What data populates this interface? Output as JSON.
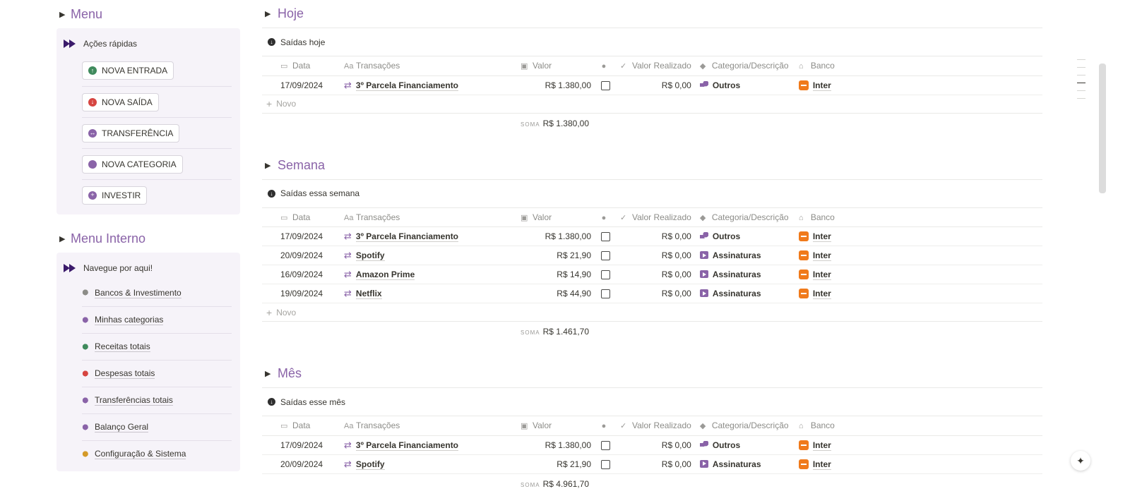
{
  "menu": {
    "title": "Menu",
    "panel_title": "Ações rápidas",
    "buttons": [
      {
        "label": "NOVA ENTRADA",
        "color": "#3f8a5c",
        "glyph": "↑"
      },
      {
        "label": "NOVA SAÍDA",
        "color": "#d64541",
        "glyph": "↓"
      },
      {
        "label": "TRANSFERÊNCIA",
        "color": "#8a63a8",
        "glyph": "↔"
      },
      {
        "label": "NOVA CATEGORIA",
        "color": "#8a63a8",
        "glyph": ""
      },
      {
        "label": "INVESTIR",
        "color": "#8a63a8",
        "glyph": "+"
      }
    ]
  },
  "menu_interno": {
    "title": "Menu Interno",
    "panel_title": "Navegue por aqui!",
    "items": [
      {
        "label": "Bancos & Investimento",
        "icon": "bank-icon"
      },
      {
        "label": "Minhas categorias",
        "icon": "shapes-icon"
      },
      {
        "label": "Receitas totais",
        "icon": "income-icon"
      },
      {
        "label": "Despesas totais",
        "icon": "expense-icon"
      },
      {
        "label": "Transferências totais",
        "icon": "transfer-icon"
      },
      {
        "label": "Balanço Geral",
        "icon": "balance-icon"
      },
      {
        "label": "Configuração & Sistema",
        "icon": "settings-icon"
      }
    ]
  },
  "columns": {
    "date": "Data",
    "transactions": "Transações",
    "value": "Valor",
    "realized": "Valor Realizado",
    "category": "Categoria/Descrição",
    "bank": "Banco"
  },
  "new_label": "Novo",
  "sum_label": "SOMA",
  "sections": [
    {
      "title": "Hoje",
      "view_title": "Saídas hoje",
      "sum": "R$ 1.380,00",
      "rows": [
        {
          "date": "17/09/2024",
          "name": "3º Parcela Financiamento",
          "value": "R$ 1.380,00",
          "realized": "R$ 0,00",
          "category": "Outros",
          "cat_icon": "outros",
          "bank": "Inter"
        }
      ],
      "show_new": true
    },
    {
      "title": "Semana",
      "view_title": "Saídas essa semana",
      "sum": "R$ 1.461,70",
      "rows": [
        {
          "date": "17/09/2024",
          "name": "3º Parcela Financiamento",
          "value": "R$ 1.380,00",
          "realized": "R$ 0,00",
          "category": "Outros",
          "cat_icon": "outros",
          "bank": "Inter"
        },
        {
          "date": "20/09/2024",
          "name": "Spotify",
          "value": "R$ 21,90",
          "realized": "R$ 0,00",
          "category": "Assinaturas",
          "cat_icon": "play",
          "bank": "Inter"
        },
        {
          "date": "16/09/2024",
          "name": "Amazon Prime",
          "value": "R$ 14,90",
          "realized": "R$ 0,00",
          "category": "Assinaturas",
          "cat_icon": "play",
          "bank": "Inter"
        },
        {
          "date": "19/09/2024",
          "name": "Netflix",
          "value": "R$ 44,90",
          "realized": "R$ 0,00",
          "category": "Assinaturas",
          "cat_icon": "play",
          "bank": "Inter"
        }
      ],
      "show_new": true
    },
    {
      "title": "Mês",
      "view_title": "Saídas esse mês",
      "sum": "R$ 4.961,70",
      "rows": [
        {
          "date": "17/09/2024",
          "name": "3º Parcela Financiamento",
          "value": "R$ 1.380,00",
          "realized": "R$ 0,00",
          "category": "Outros",
          "cat_icon": "outros",
          "bank": "Inter"
        },
        {
          "date": "20/09/2024",
          "name": "Spotify",
          "value": "R$ 21,90",
          "realized": "R$ 0,00",
          "category": "Assinaturas",
          "cat_icon": "play",
          "bank": "Inter"
        }
      ],
      "show_new": false
    }
  ]
}
